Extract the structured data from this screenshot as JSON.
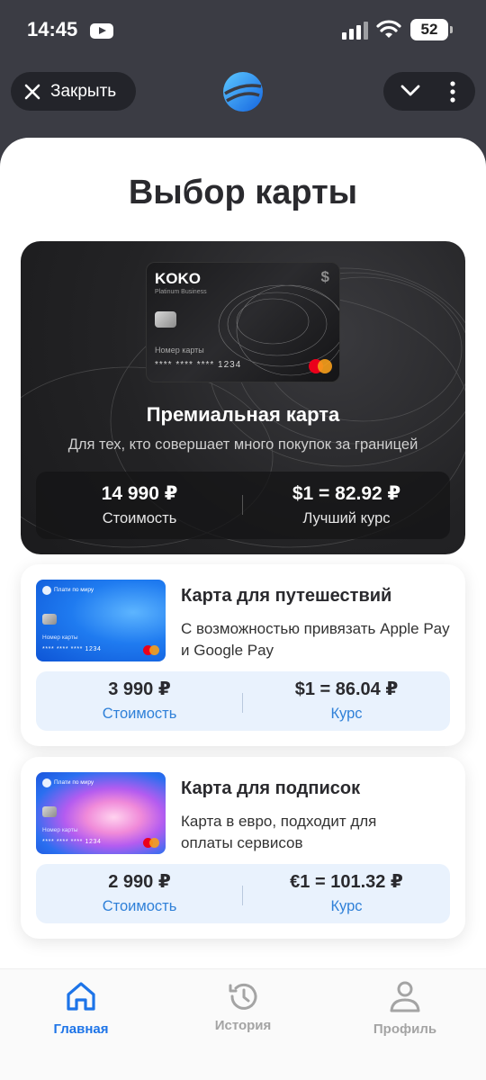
{
  "status_bar": {
    "time": "14:45",
    "battery": "52"
  },
  "top_bar": {
    "close_label": "Закрыть"
  },
  "page_title": "Выбор карты",
  "premium": {
    "card_brand": "KOKO",
    "card_sub": "Platinum Business",
    "card_currency": "$",
    "card_number_label": "Номер карты",
    "card_number": "**** **** **** 1234",
    "name": "Премиальная карта",
    "description": "Для тех, кто совершает много покупок за границей",
    "price_value": "14 990 ₽",
    "price_label": "Стоимость",
    "rate_value": "$1 = 82.92 ₽",
    "rate_label": "Лучший курс"
  },
  "cards": [
    {
      "mini_brand": "Плати по миру",
      "mini_number_label": "Номер карты",
      "mini_number": "**** **** **** 1234",
      "title": "Карта для путешествий",
      "description": "С возможностью привязать Apple Pay и Google Pay",
      "price_value": "3 990 ₽",
      "price_label": "Стоимость",
      "rate_value": "$1 = 86.04 ₽",
      "rate_label": "Курс"
    },
    {
      "mini_brand": "Плати по миру",
      "mini_number_label": "Номер карты",
      "mini_number": "**** **** **** 1234",
      "title": "Карта для подписок",
      "description": "Карта в евро, подходит для оплаты сервисов",
      "price_value": "2 990 ₽",
      "price_label": "Стоимость",
      "rate_value": "€1 = 101.32 ₽",
      "rate_label": "Курс"
    }
  ],
  "bottom_nav": {
    "items": [
      {
        "label": "Главная",
        "icon": "home-icon",
        "active": true
      },
      {
        "label": "История",
        "icon": "history-icon",
        "active": false
      },
      {
        "label": "Профиль",
        "icon": "profile-icon",
        "active": false
      }
    ]
  },
  "colors": {
    "accent": "#1d74e8",
    "link": "#2f80d8",
    "stats_bg": "#e9f2fd",
    "dark_card": "#232325"
  }
}
